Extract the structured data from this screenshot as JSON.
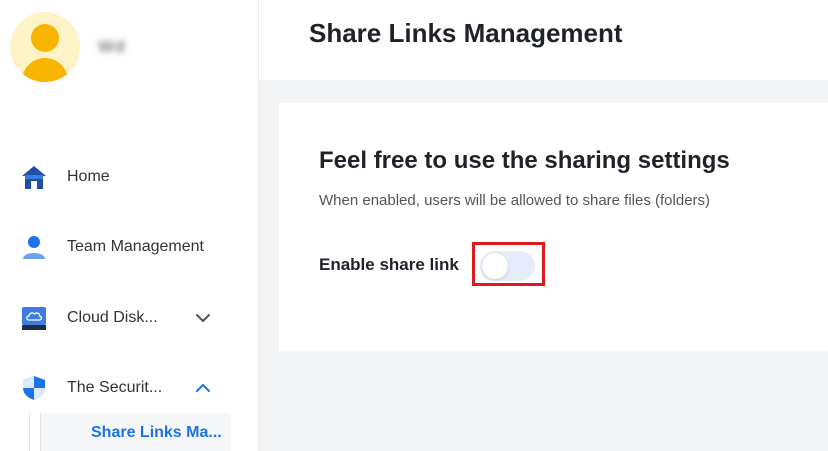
{
  "profile": {
    "username": "Wd"
  },
  "sidebar": {
    "items": [
      {
        "label": "Home",
        "icon": "home-icon"
      },
      {
        "label": "Team Management",
        "icon": "user-icon"
      },
      {
        "label": "Cloud Disk...",
        "icon": "cloud-disk-icon",
        "chevron": "chevron-down-icon"
      },
      {
        "label": "The Securit...",
        "icon": "shield-icon",
        "chevron": "chevron-up-icon"
      }
    ],
    "subitems": [
      {
        "label": "Share Links Ma..."
      }
    ]
  },
  "header": {
    "title": "Share Links Management"
  },
  "card": {
    "title": "Feel free to use the sharing settings",
    "description": "When enabled, users will be allowed to share files (folders)",
    "toggle_label": "Enable share link",
    "toggle_enabled": false
  },
  "colors": {
    "accent": "#1a73e8",
    "highlight": "#e0191e",
    "avatar": "#f7b500"
  }
}
